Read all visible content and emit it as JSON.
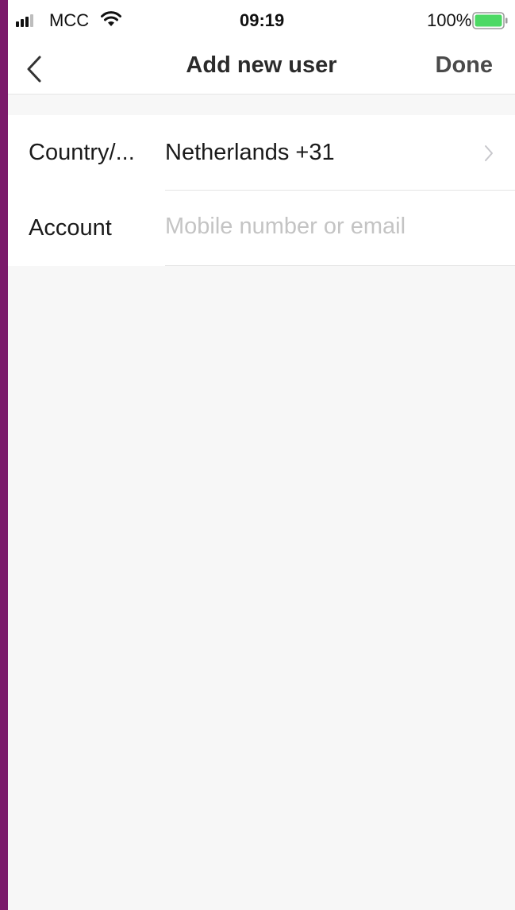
{
  "status_bar": {
    "carrier": "MCC",
    "time": "09:19",
    "battery_percent": "100%",
    "battery_level": 1.0,
    "battery_color": "#4cd964"
  },
  "nav": {
    "title": "Add new user",
    "done_label": "Done",
    "back_icon": "chevron-left-icon"
  },
  "form": {
    "country_row": {
      "label": "Country/...",
      "value": "Netherlands +31",
      "icon": "chevron-right-icon"
    },
    "account_row": {
      "label": "Account",
      "placeholder": "Mobile number or email",
      "value": ""
    }
  },
  "colors": {
    "background": "#f7f7f7",
    "frame_border": "#7b1a6b",
    "text_primary": "#1a1a1a",
    "placeholder": "#c4c4c4"
  }
}
